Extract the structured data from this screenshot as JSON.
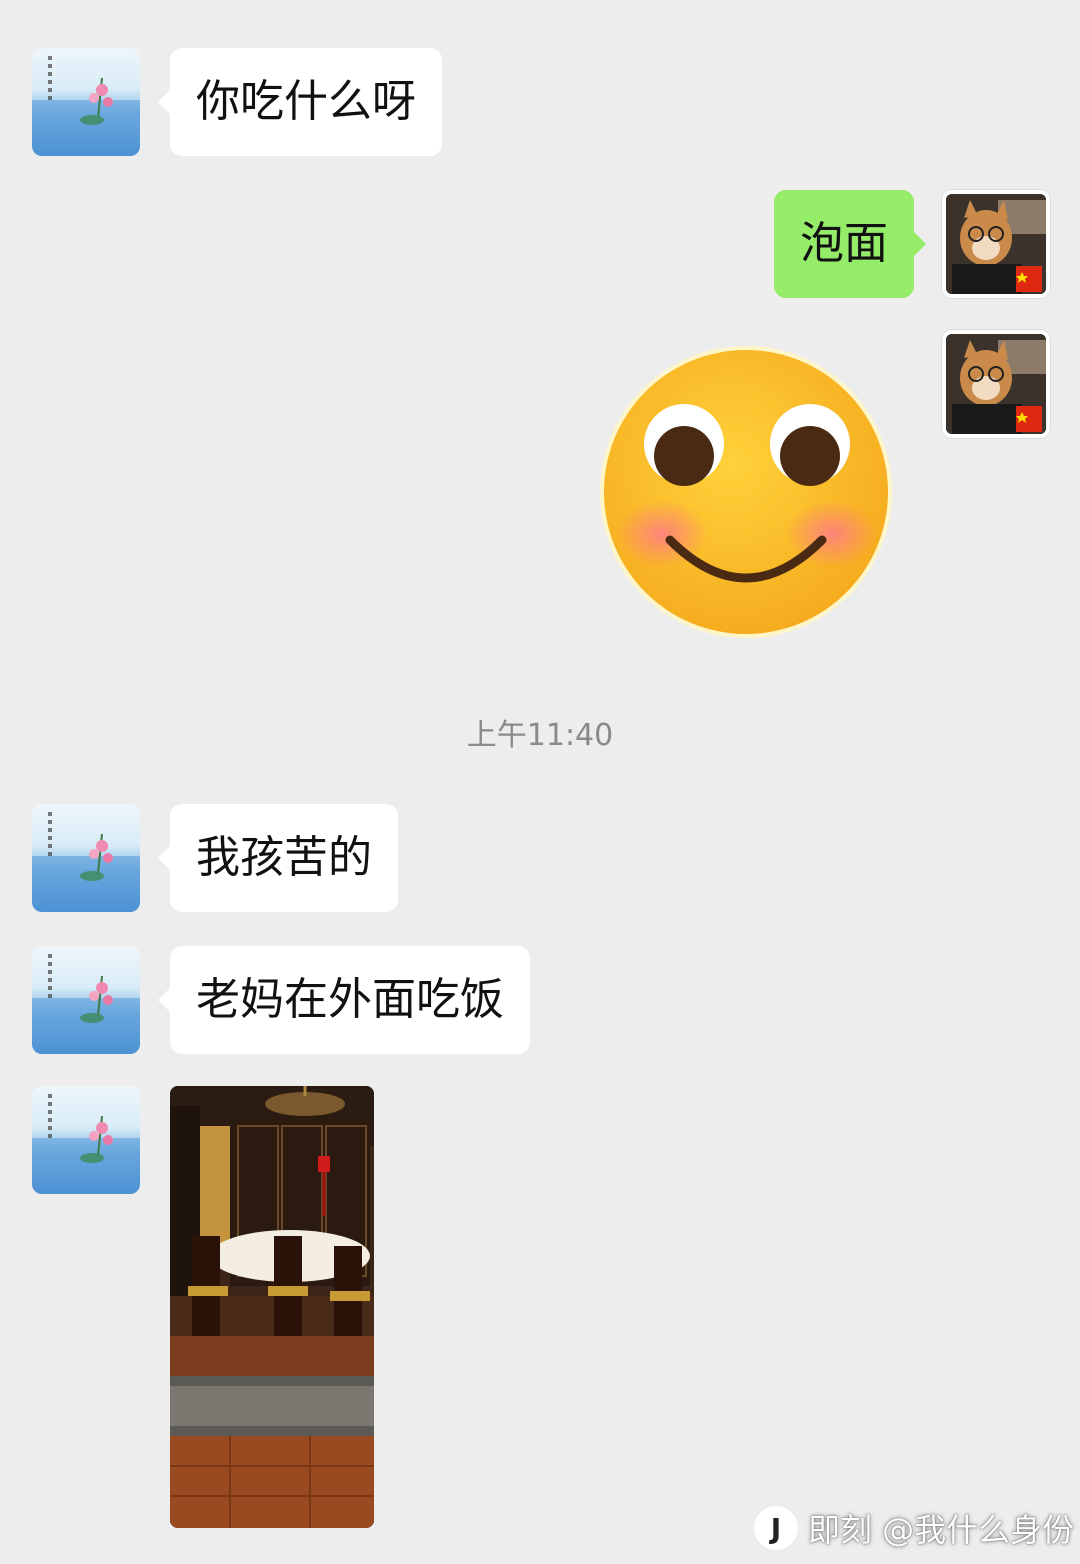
{
  "messages": [
    {
      "from": "other",
      "text": "你吃什么呀"
    },
    {
      "from": "self",
      "text": "泡面"
    },
    {
      "from": "self",
      "type": "sticker",
      "sticker": "smiling-blush-emoji"
    },
    {
      "from": "other",
      "text": "我孩苦的"
    },
    {
      "from": "other",
      "text": "老妈在外面吃饭"
    },
    {
      "from": "other",
      "type": "photo",
      "photo": "restaurant-dining-room"
    }
  ],
  "timestamp": "上午11:40",
  "watermark": {
    "logo": "J",
    "text": "即刻 @我什么身份"
  },
  "colors": {
    "background": "#ededed",
    "incoming_bubble": "#ffffff",
    "outgoing_bubble": "#95ec69",
    "timestamp": "#8a8a8a"
  }
}
